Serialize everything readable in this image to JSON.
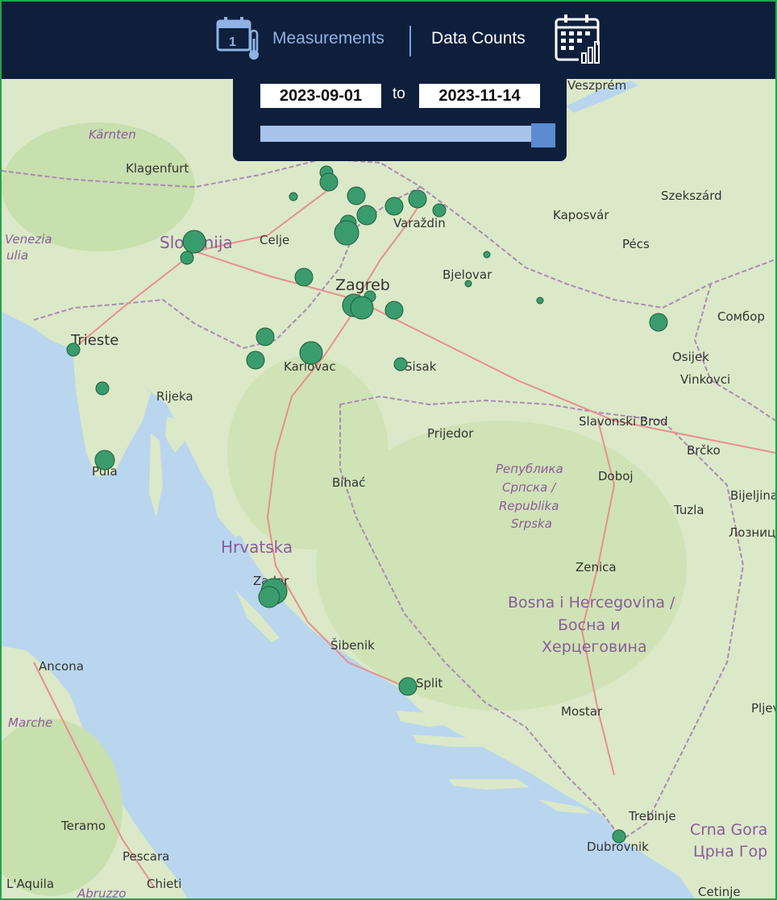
{
  "header": {
    "measurements_tab": "Measurements",
    "data_counts_tab": "Data Counts",
    "measurements_icon": "calendar-thermometer-icon",
    "data_counts_icon": "calendar-chart-icon",
    "calendar_day": "1"
  },
  "date_range": {
    "start": "2023-09-01",
    "separator": "to",
    "end": "2023-11-14",
    "slider_position_fraction": 1.0
  },
  "colors": {
    "header_bg": "#0e1f3b",
    "marker": "#3a9c6c",
    "active_tab": "#8fb2e6",
    "border": "#1fa64a"
  },
  "map_labels": {
    "cities": [
      "Klagenfurt",
      "Celje",
      "Varaždin",
      "Veszprém",
      "Kaposvár",
      "Szekszárd",
      "Pécs",
      "Bjelovar",
      "Zagreb",
      "Сомбор",
      "Osijek",
      "Vinkovci",
      "Karlovac",
      "Sisak",
      "Trieste",
      "Rijeka",
      "Pula",
      "Prijedor",
      "Slavonski Brod",
      "Brčko",
      "Bihać",
      "Doboj",
      "Bijeljina",
      "Tuzla",
      "Лозниц",
      "Zenica",
      "Zadar",
      "Šibenik",
      "Split",
      "Ancona",
      "Mostar",
      "Pljev",
      "Trebinje",
      "Dubrovnik",
      "Teramo",
      "Pescara",
      "L'Aquila",
      "Chieti",
      "Cetinje"
    ],
    "countries": [
      "Slovenija",
      "Hrvatska",
      "Bosna i Hercegovina /",
      "Босна и",
      "Херцеговина",
      "Republika",
      "Srpska",
      "Република",
      "Српска /",
      "Crna Gora",
      "Црна Гор"
    ],
    "regions": [
      "Kärnten",
      "Venezia",
      "ulia",
      "Marche",
      "Abruzzo"
    ]
  }
}
